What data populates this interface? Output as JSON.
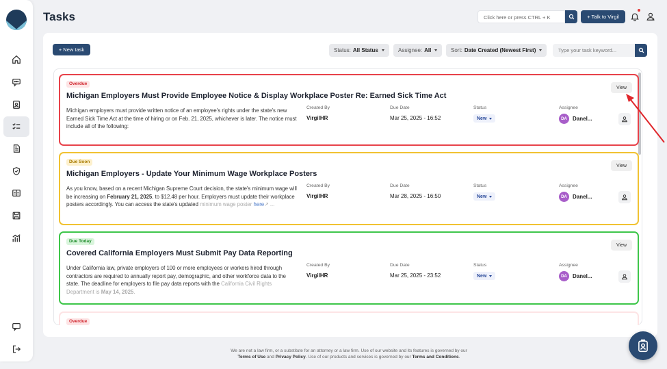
{
  "page": {
    "title": "Tasks"
  },
  "header": {
    "search_placeholder": "Click here or press CTRL + K",
    "talk_label": "+ Talk to Virgil"
  },
  "toolbar": {
    "new_task_label": "+ New task",
    "filters": [
      {
        "label": "Status:",
        "value": "All Status"
      },
      {
        "label": "Assignee:",
        "value": "All"
      },
      {
        "label": "Sort:",
        "value": "Date Created (Newest First)"
      }
    ],
    "search_placeholder": "Type your task keyword..."
  },
  "meta_labels": {
    "created_by": "Created By",
    "due_date": "Due Date",
    "status": "Status",
    "assignee": "Assignee"
  },
  "view_label": "View",
  "tasks": [
    {
      "badge": "Overdue",
      "title": "Michigan Employers Must Provide Employee Notice & Display Workplace Poster Re: Earned Sick Time Act",
      "description": "Michigan employers must provide written notice of an employee's rights under the state's new Earned Sick Time Act at the time of hiring or on Feb. 21, 2025, whichever is later. The notice must include all of the following:",
      "created_by": "VirgilHR",
      "due_date": "Mar 25, 2025 - 16:52",
      "status": "New",
      "assignee_initials": "DA",
      "assignee_name": "Danel..."
    },
    {
      "badge": "Due Soon",
      "title": "Michigan Employers - Update Your Minimum Wage Workplace Posters",
      "description_parts": {
        "p1": "As you know, based on a recent Michigan Supreme Court decision, the state's minimum wage will be increasing on ",
        "bold1": "February 21, 2025",
        "p2": ", to $12.48 per hour. Employers must update their workplace posters accordingly. You can access the state's updated ",
        "fade": "minimum wage poster ",
        "link": "here",
        "tail": " ..."
      },
      "created_by": "VirgilHR",
      "due_date": "Mar 28, 2025 - 16:50",
      "status": "New",
      "assignee_initials": "DA",
      "assignee_name": "Danel..."
    },
    {
      "badge": "Due Today",
      "title": "Covered California Employers Must Submit Pay Data Reporting",
      "description_parts": {
        "p1": "Under California law, private employers of 100 or more employees or workers hired through contractors are required to annually report pay, demographic, and other workforce data to the state. The deadline for employers to file pay data reports with the ",
        "fade": "California Civil Rights Department is ",
        "fade_bold": "May 14, 2025",
        "tail": "."
      },
      "created_by": "VirgilHR",
      "due_date": "Mar 25, 2025 - 23:52",
      "status": "New",
      "assignee_initials": "DA",
      "assignee_name": "Danel..."
    },
    {
      "badge": "Overdue"
    }
  ],
  "footer": {
    "line1": "We are not a law firm, or a substitute for an attorney or a law firm. Use of our website and its features is governed by our",
    "terms_use": "Terms of Use",
    "and": " and ",
    "privacy": "Privacy Policy",
    "line2_mid": ". Use of our products and services is governed by our ",
    "terms_conditions": "Terms and Conditions",
    "end": "."
  },
  "colors": {
    "primary": "#2a4a72",
    "overdue": "#e8424a",
    "due_soon": "#f1c232",
    "due_today": "#3ec64a",
    "avatar": "#a85ec9"
  }
}
